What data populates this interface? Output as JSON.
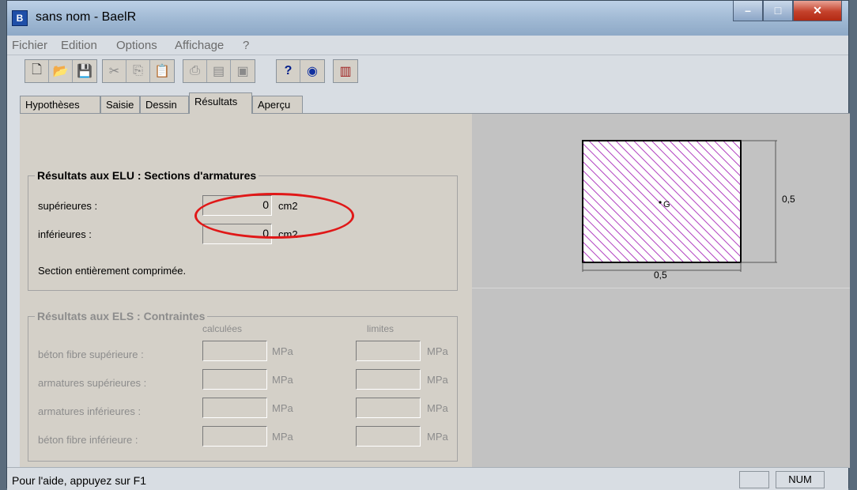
{
  "window": {
    "title": "sans nom - BaelR",
    "icon": "baelr-app-icon"
  },
  "menu": [
    "Fichier",
    "Edition",
    "Options",
    "Affichage",
    "?"
  ],
  "toolbar_icons": [
    "new-file-icon",
    "open-folder-icon",
    "save-icon",
    "cut-icon",
    "copy-icon",
    "paste-icon",
    "print-icon",
    "print-preview-icon",
    "print-setup-icon",
    "help-icon",
    "globe-icon",
    "calculator-icon"
  ],
  "tabs": [
    "Hypothèses",
    "Saisie",
    "Dessin",
    "Résultats",
    "Aperçu"
  ],
  "active_tab": "Résultats",
  "elu": {
    "title": "Résultats aux ELU : Sections d'armatures",
    "sup_label": "supérieures :",
    "sup_value": "0",
    "inf_label": "inférieures :",
    "inf_value": "0",
    "unit": "cm2",
    "message": "Section entièrement comprimée."
  },
  "els": {
    "title": "Résultats aux ELS : Contraintes",
    "col_calc": "calculées",
    "col_lim": "limites",
    "unit": "MPa",
    "rows": [
      "béton fibre supérieure :",
      "armatures supérieures :",
      "armatures inférieures :",
      "béton fibre inférieure :"
    ]
  },
  "drawing": {
    "width_label": "0,5",
    "height_label": "0,5",
    "centroid_label": "G"
  },
  "status": {
    "help": "Pour l'aide, appuyez sur F1",
    "num": "NUM"
  },
  "colors": {
    "hatch": "#b040c0",
    "annotation": "#e01818"
  }
}
